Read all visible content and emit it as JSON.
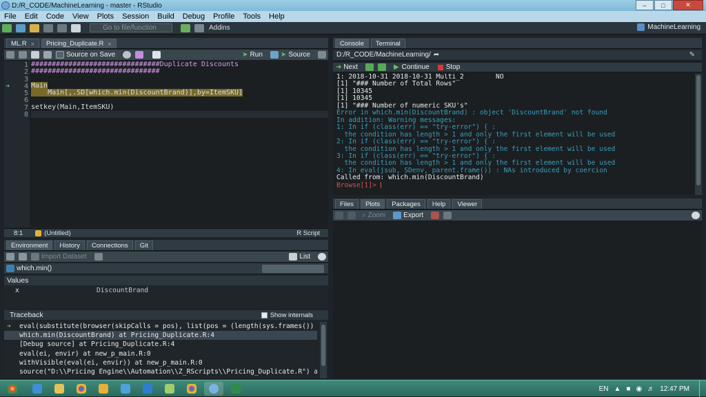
{
  "window": {
    "title": "D:/R_CODE/MachineLearning - master - RStudio"
  },
  "menu": [
    "File",
    "Edit",
    "Code",
    "View",
    "Plots",
    "Session",
    "Build",
    "Debug",
    "Profile",
    "Tools",
    "Help"
  ],
  "toolbar": {
    "goto_placeholder": "Go to file/function",
    "addins": "Addins",
    "project": "MachineLearning"
  },
  "editor": {
    "tabs": [
      {
        "label": "ML.R",
        "active": false
      },
      {
        "label": "Pricing_Duplicate.R",
        "active": true
      }
    ],
    "source_on_save": "Source on Save",
    "run": "Run",
    "source": "Source",
    "line_numbers": [
      "1",
      "2",
      "3",
      "4",
      "5",
      "6",
      "7",
      "8"
    ],
    "lines": [
      "###############################Duplicate Discounts",
      "###############################",
      "",
      "Main",
      "    Main[,.SD[which.min(DiscountBrand)],by=ItemSKU]",
      "",
      "setkey(Main,ItemSKU)",
      ""
    ],
    "status": {
      "pos": "8:1",
      "context": "(Untitled)",
      "lang": "R Script"
    }
  },
  "env": {
    "tabs": [
      "Environment",
      "History",
      "Connections",
      "Git"
    ],
    "import": "Import Dataset",
    "list": "List",
    "scope": "which.min()",
    "values_header": "Values",
    "rows": [
      {
        "name": "x",
        "value": "DiscountBrand"
      }
    ]
  },
  "traceback": {
    "title": "Traceback",
    "show_internals": "Show internals",
    "lines": [
      "eval(substitute(browser(skipCalls = pos), list(pos = (length(sys.frames()) -",
      "which.min(DiscountBrand) at Pricing_Duplicate.R:4",
      "[Debug source] at Pricing_Duplicate.R:4",
      "eval(ei, envir) at new_p_main.R:0",
      "withVisible(eval(ei, envir)) at new_p_main.R:0",
      "source(\"D:\\\\Pricing Engine\\\\Automation\\\\Z_RScripts\\\\Pricing_Duplicate.R\") at new…"
    ]
  },
  "console": {
    "tabs": [
      "Console",
      "Terminal"
    ],
    "path": "D:/R_CODE/MachineLearning/",
    "next": "Next",
    "continue": "Continue",
    "stop": "Stop",
    "lines": [
      {
        "t": "1: 2018-10-31 2018-10-31 Multi_2        NO",
        "c": "wh"
      },
      {
        "t": "[1] \"### Number of Total Rows\"",
        "c": "wh"
      },
      {
        "t": "[1] 10345",
        "c": "wh"
      },
      {
        "t": "[1] 10345",
        "c": "wh"
      },
      {
        "t": "[1] \"### Number of numeric SKU's\"",
        "c": "wh"
      },
      {
        "t": "Error in which.min(DiscountBrand) : object 'DiscountBrand' not found",
        "c": "err"
      },
      {
        "t": "In addition: Warning messages:",
        "c": "err"
      },
      {
        "t": "1: In if (class(err) == \"try-error\") { :",
        "c": "err"
      },
      {
        "t": "  the condition has length > 1 and only the first element will be used",
        "c": "err"
      },
      {
        "t": "2: In if (class(err) == \"try-error\") { :",
        "c": "err"
      },
      {
        "t": "  the condition has length > 1 and only the first element will be used",
        "c": "err"
      },
      {
        "t": "3: In if (class(err) == \"try-error\") { :",
        "c": "err"
      },
      {
        "t": "  the condition has length > 1 and only the first element will be used",
        "c": "err"
      },
      {
        "t": "4: In eval(jsub, SDenv, parent.frame()) : NAs introduced by coercion",
        "c": "err"
      },
      {
        "t": "Called from: which.min(DiscountBrand)",
        "c": "wh"
      },
      {
        "t": "Browse[1]> ",
        "c": "red"
      }
    ]
  },
  "files": {
    "tabs": [
      "Files",
      "Plots",
      "Packages",
      "Help",
      "Viewer"
    ],
    "zoom": "Zoom",
    "export": "Export"
  },
  "tray": {
    "lang": "EN",
    "time": "12:47 PM"
  }
}
